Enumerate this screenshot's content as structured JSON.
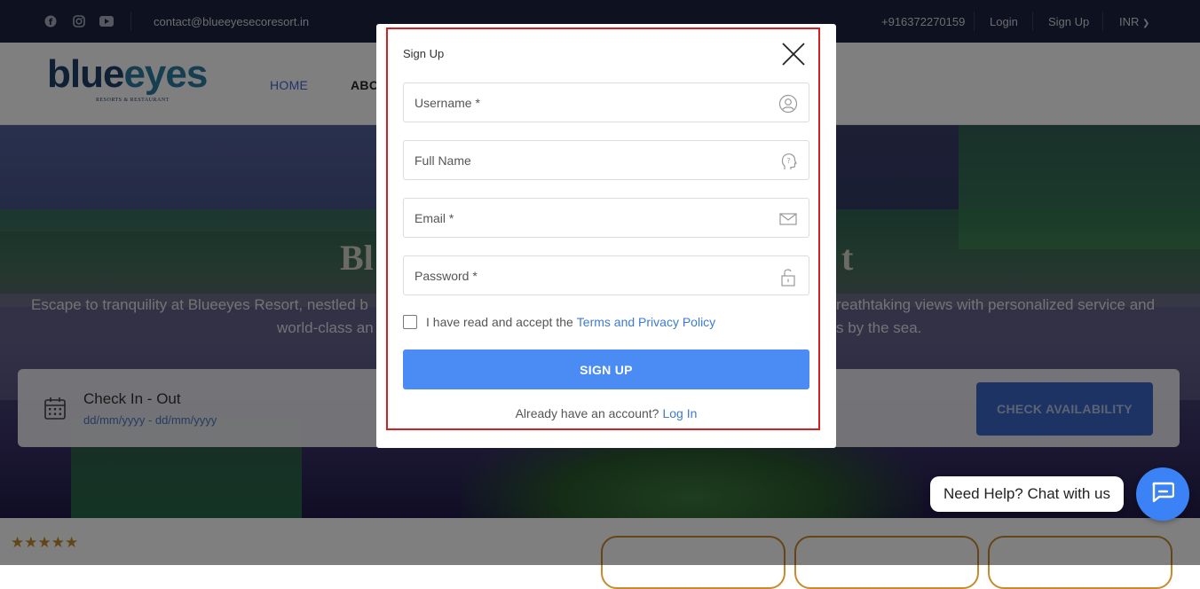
{
  "topbar": {
    "email": "contact@blueeyesecoresort.in",
    "phone": "+916372270159",
    "login": "Login",
    "signup": "Sign Up",
    "currency": "INR",
    "icons": [
      "facebook-icon",
      "instagram-icon",
      "youtube-icon"
    ]
  },
  "nav": {
    "logo_text_part1": "blue",
    "logo_text_part2": "eyes",
    "logo_sub": "RESORTS & RESTAURANT",
    "home": "HOME",
    "about": "ABO"
  },
  "hero": {
    "title_left": "Bl",
    "title_right": "t",
    "desc_line1_left": "Escape to tranquility at Blueeyes Resort, nestled b",
    "desc_line1_right": "reathtaking views with personalized service and",
    "desc_line2_left": "world-class an",
    "desc_line2_right": "s by the sea."
  },
  "booking": {
    "label": "Check In - Out",
    "dates": "dd/mm/yyyy - dd/mm/yyyy",
    "button": "CHECK AVAILABILITY"
  },
  "below": {
    "stars": "★★★★★"
  },
  "chat": {
    "bubble": "Need Help? Chat with us"
  },
  "modal": {
    "title": "Sign Up",
    "fields": {
      "username": "Username *",
      "fullname": "Full Name",
      "email": "Email *",
      "password": "Password *"
    },
    "terms_text": "I have read and accept the",
    "terms_link": "Terms and Privacy Policy",
    "submit": "SIGN UP",
    "have_account": "Already have an account?",
    "login_link": "Log In"
  },
  "colors": {
    "topbar_bg": "#1c2541",
    "accent": "#4a8cf4",
    "link": "#3e7bcf",
    "modal_border": "#d61f1f",
    "star": "#c98a2e"
  }
}
